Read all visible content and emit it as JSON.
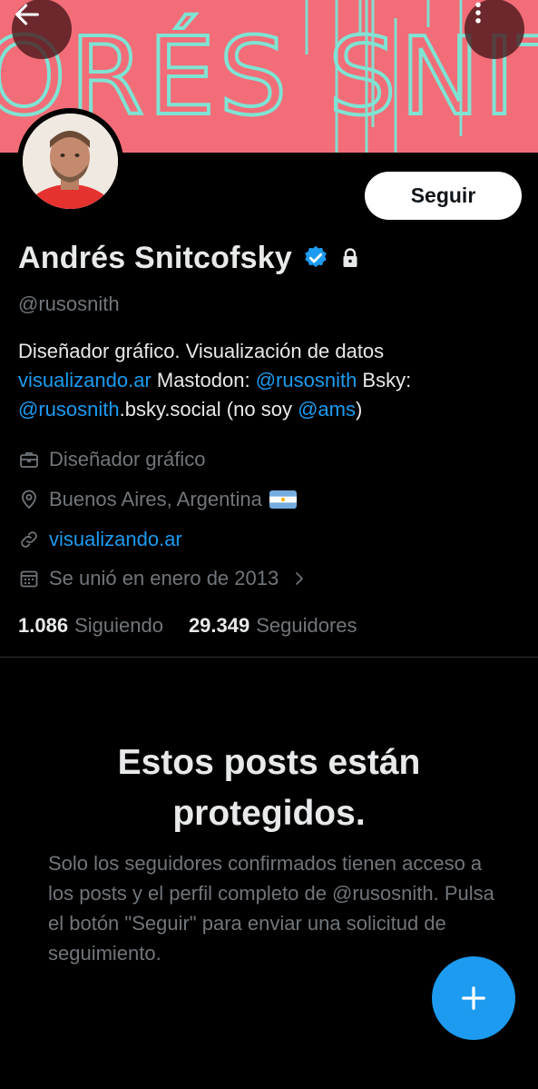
{
  "colors": {
    "banner": "#f26d78",
    "banner_text": "#7fe3d3",
    "accent": "#1d9bf0",
    "muted": "#71767b",
    "text": "#e7e9ea"
  },
  "banner": {
    "text": "ORÉS SNITCOFS",
    "back_icon": "arrow-left-icon",
    "more_icon": "more-vertical-icon"
  },
  "profile": {
    "display_name": "Andrés Snitcofsky",
    "handle": "@rusosnith",
    "follow_label": "Seguir",
    "bio": {
      "p1": "Diseñador gráfico. Visualización de datos",
      "link1": "visualizando.ar",
      "p2": " Mastodon: ",
      "mention1": "@rusosnith",
      "p3": " Bsky: ",
      "mention2": "@rusosnith",
      "p4": ".bsky.social (no soy ",
      "mention3": "@ams",
      "p5": ")"
    },
    "profession": "Diseñador gráfico",
    "location": "Buenos Aires, Argentina",
    "website": "visualizando.ar",
    "joined": "Se unió en enero de 2013",
    "following_count": "1.086",
    "following_label": "Siguiendo",
    "followers_count": "29.349",
    "followers_label": "Seguidores"
  },
  "protected": {
    "title": "Estos posts están protegidos.",
    "description": "Solo los seguidores confirmados tienen acceso a los posts y el perfil completo de @rusosnith. Pulsa el botón \"Seguir\" para enviar una solicitud de seguimiento."
  },
  "fab": {
    "icon": "plus-icon"
  }
}
